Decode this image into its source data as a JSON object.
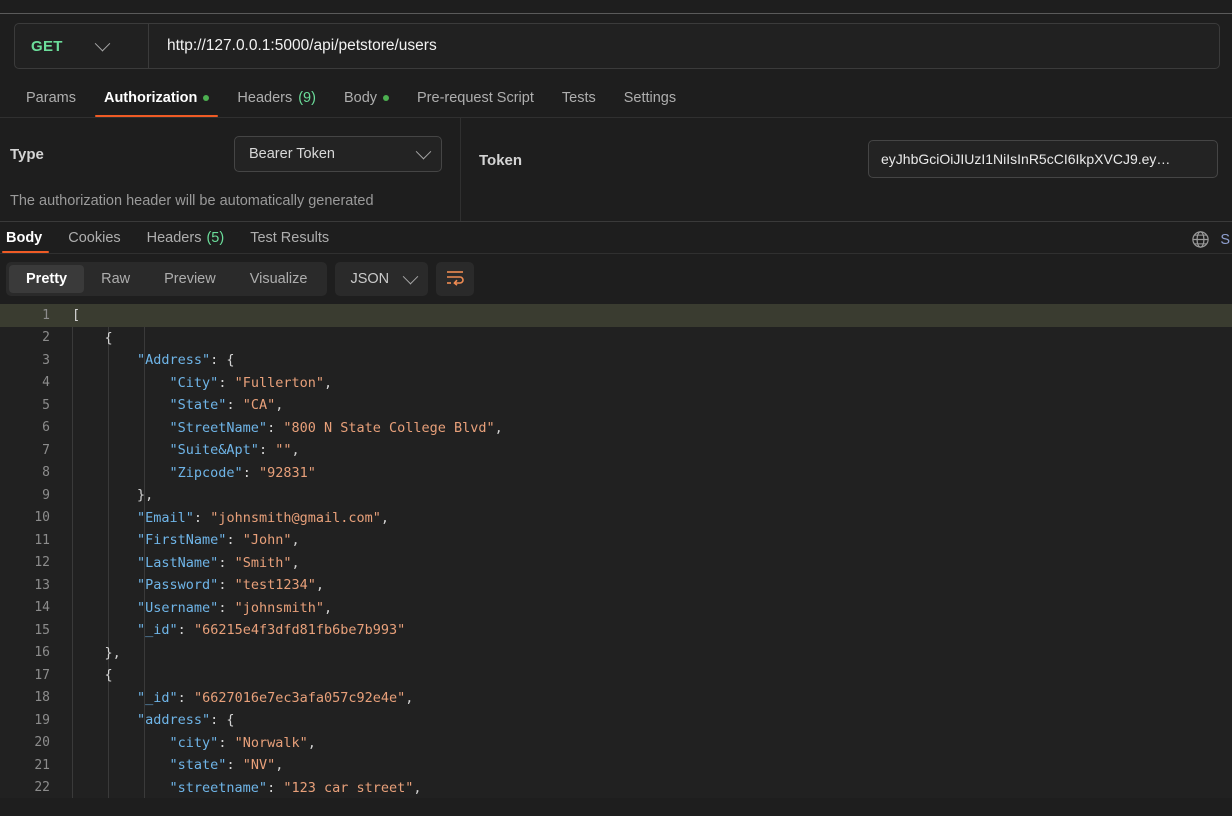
{
  "request": {
    "method": "GET",
    "method_chevron_icon": "chevron-down-icon",
    "url": "http://127.0.0.1:5000/api/petstore/users",
    "tabs": [
      {
        "label": "Params",
        "active": false,
        "dot": false,
        "count": ""
      },
      {
        "label": "Authorization",
        "active": true,
        "dot": true,
        "count": ""
      },
      {
        "label": "Headers",
        "active": false,
        "dot": false,
        "count": "(9)"
      },
      {
        "label": "Body",
        "active": false,
        "dot": true,
        "count": ""
      },
      {
        "label": "Pre-request Script",
        "active": false,
        "dot": false,
        "count": ""
      },
      {
        "label": "Tests",
        "active": false,
        "dot": false,
        "count": ""
      },
      {
        "label": "Settings",
        "active": false,
        "dot": false,
        "count": ""
      }
    ]
  },
  "authorization": {
    "type_label": "Type",
    "type_value": "Bearer Token",
    "type_chevron_icon": "chevron-down-icon",
    "note": "The authorization header will be automatically generated",
    "token_label": "Token",
    "token_value": "eyJhbGciOiJIUzI1NiIsInR5cCI6IkpXVCJ9.ey…"
  },
  "response": {
    "tabs": [
      {
        "label": "Body",
        "active": true,
        "count": ""
      },
      {
        "label": "Cookies",
        "active": false,
        "count": ""
      },
      {
        "label": "Headers",
        "active": false,
        "count": "(5)"
      },
      {
        "label": "Test Results",
        "active": false,
        "count": ""
      }
    ],
    "globe_icon": "globe-icon",
    "save_label": "S",
    "view_modes": [
      {
        "label": "Pretty",
        "active": true
      },
      {
        "label": "Raw",
        "active": false
      },
      {
        "label": "Preview",
        "active": false
      },
      {
        "label": "Visualize",
        "active": false
      }
    ],
    "format": "JSON",
    "format_chevron_icon": "chevron-down-icon",
    "wrap_icon": "word-wrap-icon"
  },
  "code": {
    "lines": [
      {
        "n": "1",
        "tokens": [
          {
            "t": "p",
            "v": "["
          }
        ],
        "highlight": true
      },
      {
        "n": "2",
        "tokens": [
          {
            "t": "p",
            "v": "    {"
          }
        ],
        "highlight": false
      },
      {
        "n": "3",
        "tokens": [
          {
            "t": "k",
            "v": "        \"Address\""
          },
          {
            "t": "p",
            "v": ": {"
          }
        ],
        "highlight": false
      },
      {
        "n": "4",
        "tokens": [
          {
            "t": "k",
            "v": "            \"City\""
          },
          {
            "t": "p",
            "v": ": "
          },
          {
            "t": "s",
            "v": "\"Fullerton\""
          },
          {
            "t": "p",
            "v": ","
          }
        ],
        "highlight": false
      },
      {
        "n": "5",
        "tokens": [
          {
            "t": "k",
            "v": "            \"State\""
          },
          {
            "t": "p",
            "v": ": "
          },
          {
            "t": "s",
            "v": "\"CA\""
          },
          {
            "t": "p",
            "v": ","
          }
        ],
        "highlight": false
      },
      {
        "n": "6",
        "tokens": [
          {
            "t": "k",
            "v": "            \"StreetName\""
          },
          {
            "t": "p",
            "v": ": "
          },
          {
            "t": "s",
            "v": "\"800 N State College Blvd\""
          },
          {
            "t": "p",
            "v": ","
          }
        ],
        "highlight": false
      },
      {
        "n": "7",
        "tokens": [
          {
            "t": "k",
            "v": "            \"Suite&Apt\""
          },
          {
            "t": "p",
            "v": ": "
          },
          {
            "t": "s",
            "v": "\"\""
          },
          {
            "t": "p",
            "v": ","
          }
        ],
        "highlight": false
      },
      {
        "n": "8",
        "tokens": [
          {
            "t": "k",
            "v": "            \"Zipcode\""
          },
          {
            "t": "p",
            "v": ": "
          },
          {
            "t": "s",
            "v": "\"92831\""
          }
        ],
        "highlight": false
      },
      {
        "n": "9",
        "tokens": [
          {
            "t": "p",
            "v": "        },"
          }
        ],
        "highlight": false
      },
      {
        "n": "10",
        "tokens": [
          {
            "t": "k",
            "v": "        \"Email\""
          },
          {
            "t": "p",
            "v": ": "
          },
          {
            "t": "s",
            "v": "\"johnsmith@gmail.com\""
          },
          {
            "t": "p",
            "v": ","
          }
        ],
        "highlight": false
      },
      {
        "n": "11",
        "tokens": [
          {
            "t": "k",
            "v": "        \"FirstName\""
          },
          {
            "t": "p",
            "v": ": "
          },
          {
            "t": "s",
            "v": "\"John\""
          },
          {
            "t": "p",
            "v": ","
          }
        ],
        "highlight": false
      },
      {
        "n": "12",
        "tokens": [
          {
            "t": "k",
            "v": "        \"LastName\""
          },
          {
            "t": "p",
            "v": ": "
          },
          {
            "t": "s",
            "v": "\"Smith\""
          },
          {
            "t": "p",
            "v": ","
          }
        ],
        "highlight": false
      },
      {
        "n": "13",
        "tokens": [
          {
            "t": "k",
            "v": "        \"Password\""
          },
          {
            "t": "p",
            "v": ": "
          },
          {
            "t": "s",
            "v": "\"test1234\""
          },
          {
            "t": "p",
            "v": ","
          }
        ],
        "highlight": false
      },
      {
        "n": "14",
        "tokens": [
          {
            "t": "k",
            "v": "        \"Username\""
          },
          {
            "t": "p",
            "v": ": "
          },
          {
            "t": "s",
            "v": "\"johnsmith\""
          },
          {
            "t": "p",
            "v": ","
          }
        ],
        "highlight": false
      },
      {
        "n": "15",
        "tokens": [
          {
            "t": "k",
            "v": "        \"_id\""
          },
          {
            "t": "p",
            "v": ": "
          },
          {
            "t": "s",
            "v": "\"66215e4f3dfd81fb6be7b993\""
          }
        ],
        "highlight": false
      },
      {
        "n": "16",
        "tokens": [
          {
            "t": "p",
            "v": "    },"
          }
        ],
        "highlight": false
      },
      {
        "n": "17",
        "tokens": [
          {
            "t": "p",
            "v": "    {"
          }
        ],
        "highlight": false
      },
      {
        "n": "18",
        "tokens": [
          {
            "t": "k",
            "v": "        \"_id\""
          },
          {
            "t": "p",
            "v": ": "
          },
          {
            "t": "s",
            "v": "\"6627016e7ec3afa057c92e4e\""
          },
          {
            "t": "p",
            "v": ","
          }
        ],
        "highlight": false
      },
      {
        "n": "19",
        "tokens": [
          {
            "t": "k",
            "v": "        \"address\""
          },
          {
            "t": "p",
            "v": ": {"
          }
        ],
        "highlight": false
      },
      {
        "n": "20",
        "tokens": [
          {
            "t": "k",
            "v": "            \"city\""
          },
          {
            "t": "p",
            "v": ": "
          },
          {
            "t": "s",
            "v": "\"Norwalk\""
          },
          {
            "t": "p",
            "v": ","
          }
        ],
        "highlight": false
      },
      {
        "n": "21",
        "tokens": [
          {
            "t": "k",
            "v": "            \"state\""
          },
          {
            "t": "p",
            "v": ": "
          },
          {
            "t": "s",
            "v": "\"NV\""
          },
          {
            "t": "p",
            "v": ","
          }
        ],
        "highlight": false
      },
      {
        "n": "22",
        "tokens": [
          {
            "t": "k",
            "v": "            \"streetname\""
          },
          {
            "t": "p",
            "v": ": "
          },
          {
            "t": "s",
            "v": "\"123 car street\""
          },
          {
            "t": "p",
            "v": ","
          }
        ],
        "highlight": false
      }
    ]
  },
  "colors": {
    "accent": "#ef5b25",
    "method": "#6bdd9a",
    "key": "#6fb5e8",
    "string": "#e8a07a",
    "highlight_line": "#3a3c30"
  }
}
